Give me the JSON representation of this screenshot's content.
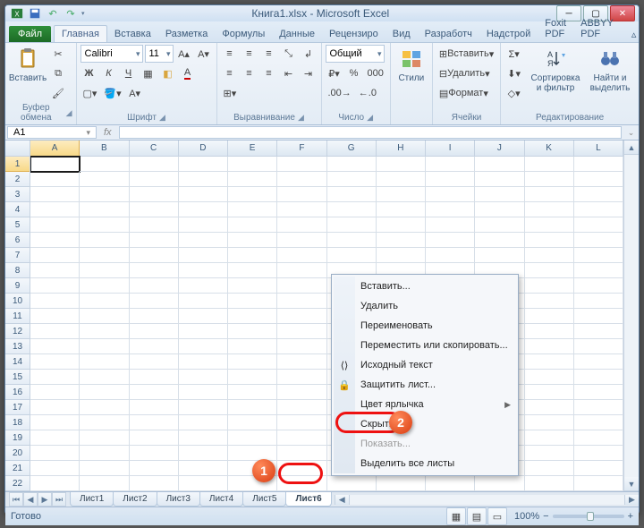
{
  "title": "Книга1.xlsx - Microsoft Excel",
  "quick_access": {
    "save": "💾",
    "undo": "↶",
    "redo": "↷"
  },
  "tabs": {
    "file": "Файл",
    "items": [
      "Главная",
      "Вставка",
      "Разметка",
      "Формулы",
      "Данные",
      "Рецензиро",
      "Вид",
      "Разработч",
      "Надстрой",
      "Foxit PDF",
      "ABBYY PDF"
    ],
    "active_index": 0
  },
  "ribbon": {
    "clipboard": {
      "paste": "Вставить",
      "label": "Буфер обмена"
    },
    "font": {
      "name": "Calibri",
      "size": "11",
      "bold": "Ж",
      "italic": "К",
      "underline": "Ч",
      "label": "Шрифт"
    },
    "align": {
      "label": "Выравнивание"
    },
    "number": {
      "format": "Общий",
      "label": "Число"
    },
    "styles": {
      "styles_btn": "Стили",
      "label": ""
    },
    "cells": {
      "insert": "Вставить",
      "delete": "Удалить",
      "format": "Формат",
      "label": "Ячейки"
    },
    "editing": {
      "sort": "Сортировка и фильтр",
      "find": "Найти и выделить",
      "label": "Редактирование"
    }
  },
  "formula_bar": {
    "namebox": "A1",
    "fx": "fx"
  },
  "columns": [
    "A",
    "B",
    "C",
    "D",
    "E",
    "F",
    "G",
    "H",
    "I",
    "J",
    "K",
    "L"
  ],
  "rows": [
    "1",
    "2",
    "3",
    "4",
    "5",
    "6",
    "7",
    "8",
    "9",
    "10",
    "11",
    "12",
    "13",
    "14",
    "15",
    "16",
    "17",
    "18",
    "19",
    "20",
    "21",
    "22"
  ],
  "sheets": [
    "Лист1",
    "Лист2",
    "Лист3",
    "Лист4",
    "Лист5",
    "Лист6"
  ],
  "active_sheet_index": 5,
  "status": {
    "ready": "Готово",
    "zoom": "100%"
  },
  "context_menu": [
    {
      "label": "Вставить...",
      "disabled": false
    },
    {
      "label": "Удалить",
      "disabled": false
    },
    {
      "label": "Переименовать",
      "disabled": false
    },
    {
      "label": "Переместить или скопировать...",
      "disabled": false
    },
    {
      "label": "Исходный текст",
      "disabled": false,
      "icon": "code-icon"
    },
    {
      "label": "Защитить лист...",
      "disabled": false,
      "icon": "lock-icon"
    },
    {
      "label": "Цвет ярлычка",
      "disabled": false,
      "submenu": true
    },
    {
      "label": "Скрыть",
      "disabled": false
    },
    {
      "label": "Показать...",
      "disabled": true
    },
    {
      "label": "Выделить все листы",
      "disabled": false
    }
  ],
  "annotations": {
    "one": "1",
    "two": "2"
  }
}
